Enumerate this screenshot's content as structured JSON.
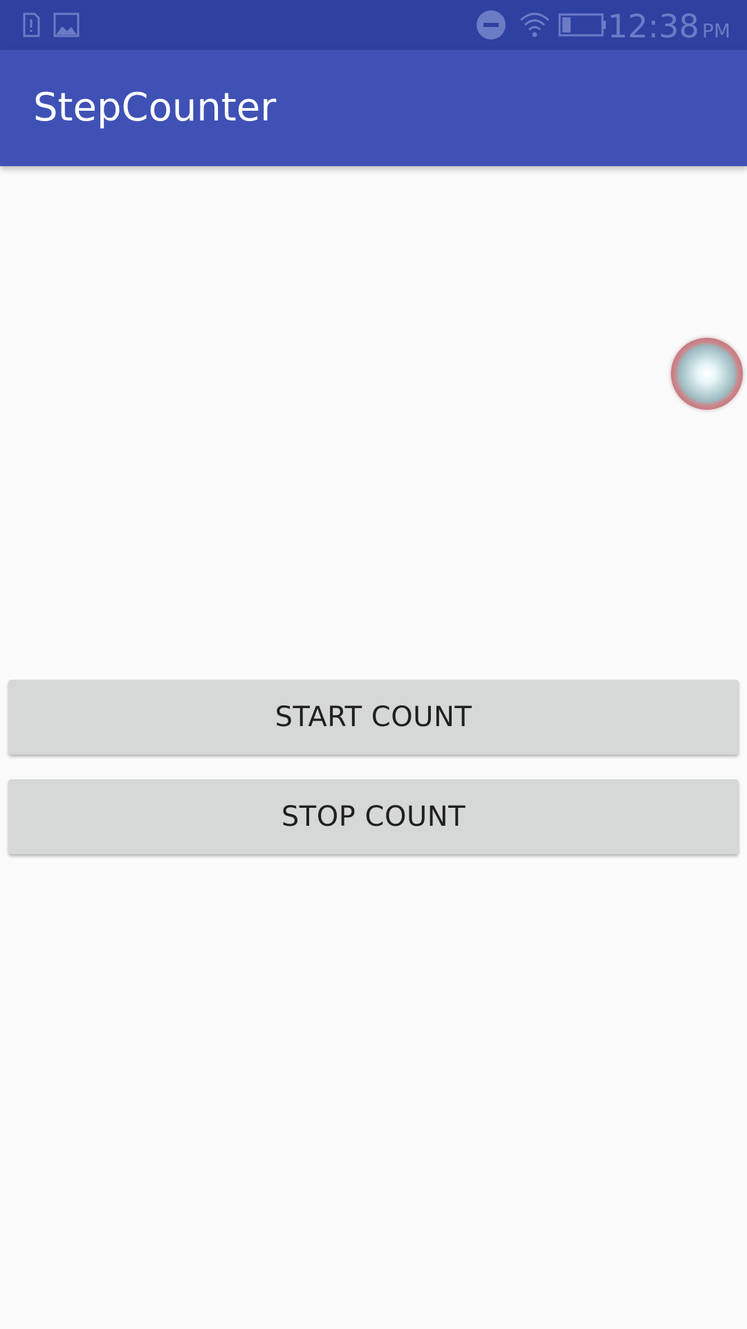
{
  "status_bar": {
    "icons": [
      "sim-alert-icon",
      "image-notification-icon",
      "do-not-disturb-icon",
      "wifi-icon",
      "battery-icon"
    ],
    "time": "12:38",
    "ampm": "PM"
  },
  "app_bar": {
    "title": "StepCounter",
    "color": "#3f51b5"
  },
  "main": {
    "start_button_label": "START COUNT",
    "stop_button_label": "STOP COUNT"
  },
  "overlay": {
    "assistive_touch_icon": "assistive-touch-icon"
  }
}
